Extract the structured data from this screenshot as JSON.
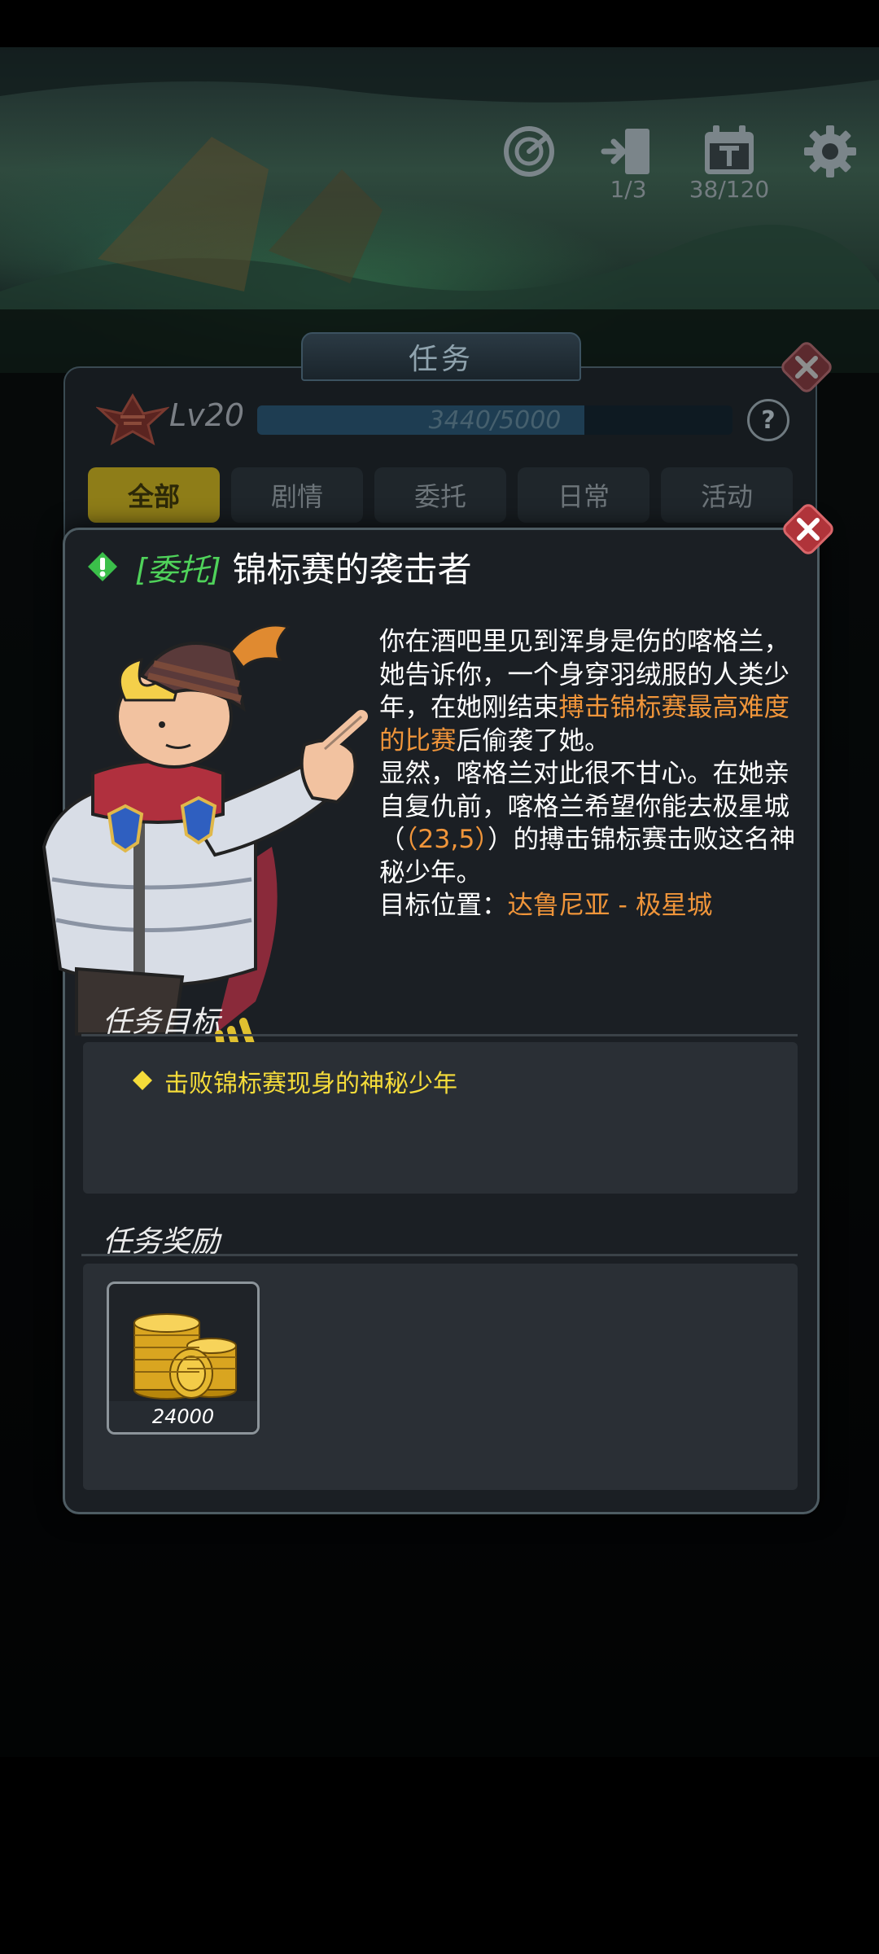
{
  "hud": {
    "rank_icon": "radar-icon",
    "exit": {
      "icon": "door-exit-icon",
      "count": "1/3"
    },
    "stamina": {
      "icon": "calendar-icon",
      "count": "38/120"
    },
    "settings_icon": "gear-icon"
  },
  "quest_window": {
    "title": "任务",
    "level": "Lv20",
    "xp": {
      "text": "3440/5000",
      "current": 3440,
      "max": 5000
    },
    "help_label": "?",
    "tabs": [
      {
        "label": "全部",
        "active": true
      },
      {
        "label": "剧情",
        "active": false
      },
      {
        "label": "委托",
        "active": false
      },
      {
        "label": "日常",
        "active": false
      },
      {
        "label": "活动",
        "active": false
      }
    ]
  },
  "detail": {
    "tag": "[委托]",
    "title": "锦标赛的袭击者",
    "description": {
      "p1_a": "你在酒吧里见到浑身是伤的喀格兰，她告诉你，一个身穿羽绒服的人类少年，在她刚结束",
      "p1_highlight": "搏击锦标赛最高难度的比赛",
      "p1_b": "后偷袭了她。",
      "p2_a": "显然，喀格兰对此很不甘心。在她亲自复仇前，喀格兰希望你能去极星城（",
      "p2_coords": "（23,5）",
      "p2_b": "）的搏击锦标赛击败这名神秘少年。",
      "target_label": "目标位置：",
      "target_location": "达鲁尼亚 - 极星城"
    },
    "objectives_header": "任务目标",
    "objectives": [
      "击败锦标赛现身的神秘少年"
    ],
    "rewards_header": "任务奖励",
    "rewards": [
      {
        "icon": "gold-coins-icon",
        "amount": "24000"
      }
    ]
  },
  "colors": {
    "accent_gold": "#8e7d18",
    "tag_green": "#4fd25a",
    "highlight_orange": "#f0953a",
    "objective_yellow": "#f5dc3a",
    "close_red": "#a8343a"
  }
}
